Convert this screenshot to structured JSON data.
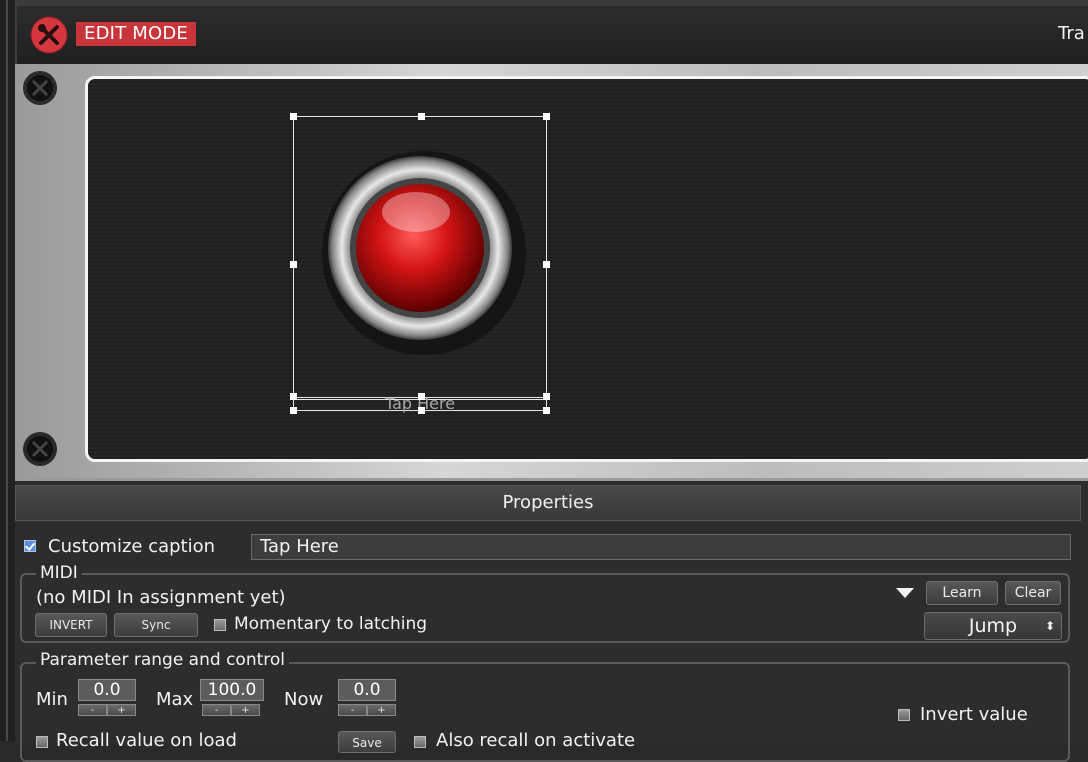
{
  "topbar": {
    "edit_mode_label": "EDIT MODE",
    "right_label": "Tra"
  },
  "stage": {
    "caption": "Tap Here"
  },
  "properties": {
    "title": "Properties",
    "customize_caption_label": "Customize caption",
    "customize_caption_checked": true,
    "caption_value": "Tap Here",
    "midi": {
      "title": "MIDI",
      "status": "(no MIDI In assignment yet)",
      "learn_label": "Learn",
      "clear_label": "Clear",
      "invert_label": "INVERT",
      "sync_label": "Sync",
      "momentary_label": "Momentary to latching",
      "mode_value": "Jump"
    },
    "param": {
      "title": "Parameter range and control",
      "min_label": "Min",
      "min_value": "0.0",
      "max_label": "Max",
      "max_value": "100.0",
      "now_label": "Now",
      "now_value": "0.0",
      "step_minus": "-",
      "step_plus": "+",
      "invert_value_label": "Invert value",
      "recall_label": "Recall value on load",
      "save_label": "Save",
      "also_recall_label": "Also recall on activate"
    }
  },
  "colors": {
    "accent_red": "#c8353b",
    "checkbox_blue": "#5d8fd8"
  },
  "icons": [
    "edit-mode-close-icon",
    "screw-icon",
    "dropdown-arrow-icon"
  ]
}
